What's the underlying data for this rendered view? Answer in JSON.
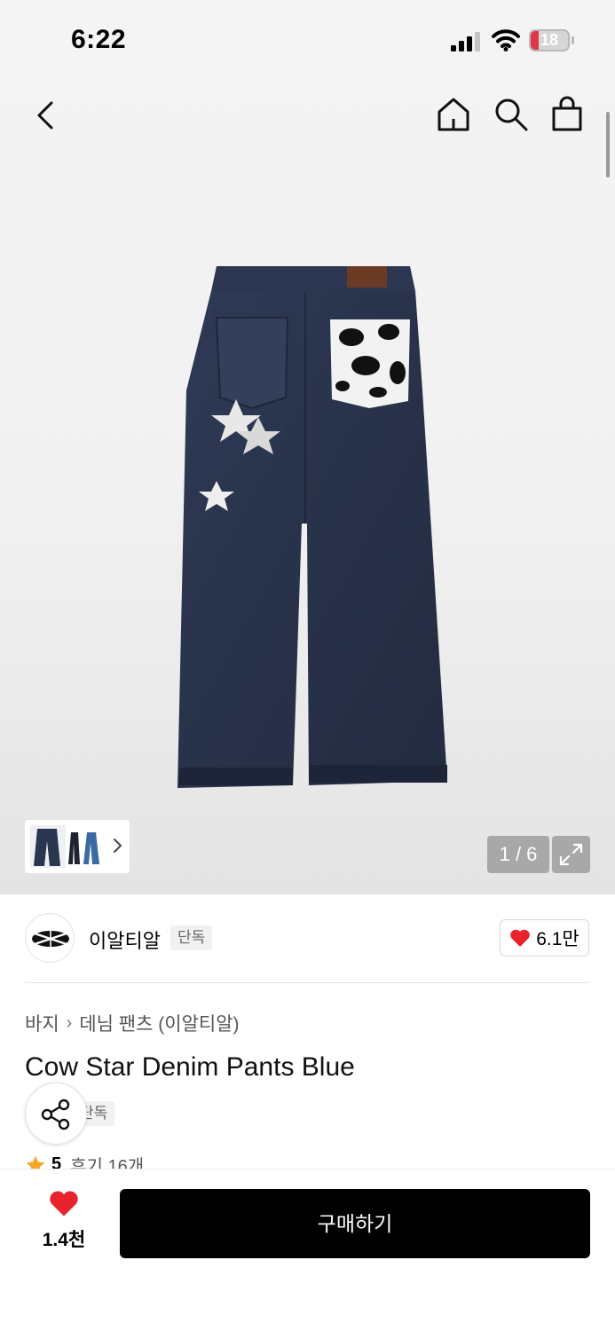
{
  "status_bar": {
    "time": "6:22",
    "battery_level": "18"
  },
  "colors": {
    "heart": "#e8232b",
    "buy_button": "#000000",
    "star": "#f5a623",
    "battery_low": "#e0364a"
  },
  "icons": {
    "back": "chevron-left-icon",
    "home": "home-icon",
    "search": "search-icon",
    "bag": "shopping-bag-icon",
    "expand": "expand-icon",
    "share": "share-icon",
    "heart": "heart-icon",
    "star": "star-icon"
  },
  "gallery": {
    "counter": "1 / 6"
  },
  "brand": {
    "name": "이알티알",
    "tag": "단독",
    "like_count": "6.1만"
  },
  "product": {
    "breadcrumb": [
      "바지",
      "데님 팬츠 (이알티알)"
    ],
    "title": "Cow Star Denim Pants Blue",
    "tag": "단독",
    "rating": "5",
    "review_text": "후기 16개"
  },
  "bottom": {
    "wish_count": "1.4천",
    "buy_label": "구매하기"
  }
}
